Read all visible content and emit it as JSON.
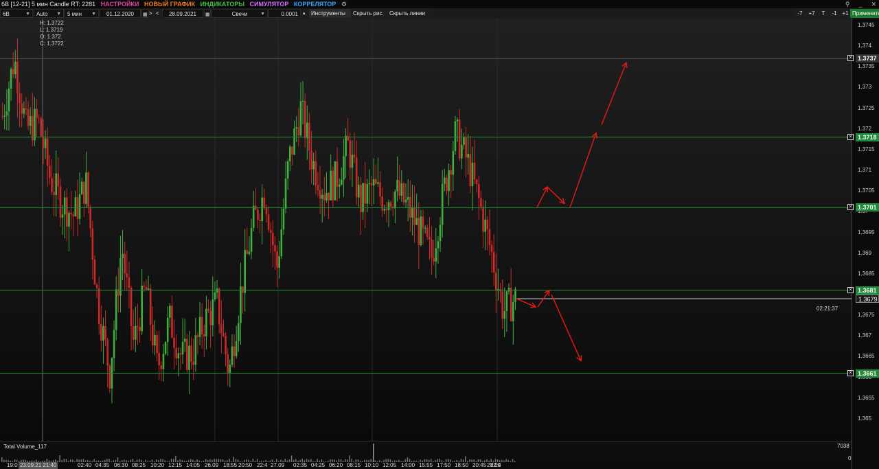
{
  "titlebar": {
    "title": "6B [12-21] 5 мин Candle RT: 2281",
    "menus": [
      {
        "label": "НАСТРОЙКИ",
        "color": "#e040a0"
      },
      {
        "label": "НОВЫЙ ГРАФИК",
        "color": "#f07a20"
      },
      {
        "label": "ИНДИКАТОРЫ",
        "color": "#40c040"
      },
      {
        "label": "СИМУЛЯТОР",
        "color": "#d070ff"
      },
      {
        "label": "КОРРЕЛЯТОР",
        "color": "#3aa0ff"
      }
    ],
    "icons": [
      "settings-cog-icon",
      "pin-icon",
      "minimize-icon",
      "close-icon"
    ]
  },
  "toolbar": {
    "symbol": "6B",
    "scale": "Auto",
    "timeframe": "5 мин",
    "date_from": "01.12.2020",
    "nav_forward": ">",
    "nav_back": "<",
    "date_to": "28.09.2021",
    "chart_type": "Свечи",
    "tick_size": "0.0001",
    "instruments": "Инструменты",
    "hide_drawings": "Скрыть рис.",
    "hide_lines": "Скрыть линии",
    "btn_minus7": "-7",
    "btn_plus7": "+7",
    "btn_t": "T",
    "btn_minus1": "-1",
    "btn_plus1": "+1",
    "apply": "Применить"
  },
  "ohlc": {
    "h": "H: 1.3722",
    "l": "L: 1.3719",
    "o": "O: 1.372",
    "c": "C: 1.3722"
  },
  "chart_data": {
    "type": "candlestick",
    "y_range": [
      1.3645,
      1.3745
    ],
    "y_ticks": [
      "1.3745",
      "1.374",
      "1.3735",
      "1.373",
      "1.3725",
      "1.372",
      "1.3715",
      "1.371",
      "1.3705",
      "1.37",
      "1.3695",
      "1.369",
      "1.3685",
      "1.368",
      "1.3675",
      "1.367",
      "1.3665",
      "1.366",
      "1.3655",
      "1.365"
    ],
    "levels": [
      {
        "value": 1.3737,
        "label": "1.3737",
        "color": "#555555"
      },
      {
        "value": 1.3718,
        "label": "1.3718",
        "color": "#1f8a3a"
      },
      {
        "value": 1.3701,
        "label": "1.3701",
        "color": "#1f8a3a"
      },
      {
        "value": 1.3681,
        "label": "1.3681",
        "color": "#1f8a3a"
      },
      {
        "value": 1.3661,
        "label": "1.3661",
        "color": "#1f8a3a"
      }
    ],
    "current_price": "1.3679",
    "timer": "02:21:37",
    "path": [
      1.3723,
      1.3737,
      1.372,
      1.3722,
      1.3708,
      1.3702,
      1.3699,
      1.3707,
      1.3678,
      1.3661,
      1.3692,
      1.3668,
      1.3682,
      1.3662,
      1.3674,
      1.3665,
      1.3666,
      1.3674,
      1.3678,
      1.3661,
      1.3681,
      1.3697,
      1.3705,
      1.3686,
      1.3712,
      1.3725,
      1.3712,
      1.3705,
      1.3708,
      1.3716,
      1.3702,
      1.3706,
      1.3703,
      1.3705,
      1.3701,
      1.3695,
      1.3689,
      1.3705,
      1.3719,
      1.3712,
      1.3702,
      1.369,
      1.3676,
      1.3679
    ]
  },
  "volume": {
    "title": "Total Volume_117",
    "max_label": "7038",
    "min_label": "0"
  },
  "xaxis": {
    "labels": [
      "19:0",
      "23.09.21 21:40",
      "02:40",
      "04:35",
      "06:30",
      "08:25",
      "10:20",
      "12:15",
      "14:05",
      "26.09",
      "18:55",
      "20:50",
      "22:4",
      "27.09",
      "02:35",
      "04:25",
      "06:20",
      "08:15",
      "10:10",
      "12:05",
      "14:00",
      "15:55",
      "17:50",
      "18:50",
      "20:45",
      "22:4",
      "28.09"
    ]
  }
}
